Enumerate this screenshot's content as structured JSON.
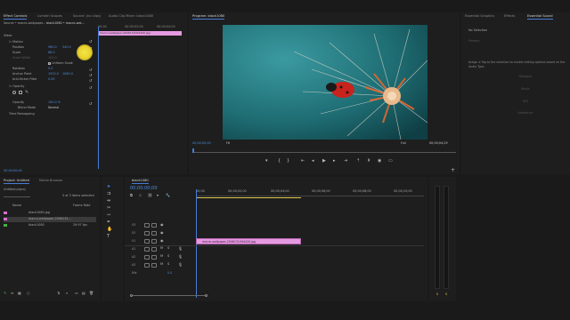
{
  "source_panel": {
    "tabs": [
      "Effect Controls",
      "Lumetri Scopes",
      "Source: (no clips)",
      "Audio Clip Mixer: black1080"
    ],
    "clip_select": "Source • macro-wallpaper...",
    "clip_select_2": "black1080 • macro-wal...",
    "section_video": "Video",
    "fx_motion": "Motion",
    "position_label": "Position",
    "position_x": "960.0",
    "position_y": "540.0",
    "scale_label": "Scale",
    "scale_value": "66.0",
    "scale_width_label": "Scale Width",
    "scale_width_value": "100.0",
    "uniform_scale": "Uniform Scale",
    "rotation_label": "Rotation",
    "rotation_value": "0.0",
    "anchor_label": "Anchor Point",
    "anchor_x": "1920.0",
    "anchor_y": "1080.0",
    "antiflicker_label": "Anti-flicker Filter",
    "antiflicker_value": "0.00",
    "opacity_section": "Opacity",
    "opacity_label": "Opacity",
    "opacity_value": "100.0 %",
    "blend_label": "Blend Mode",
    "blend_value": "Normal",
    "time_remap": "Time Remapping",
    "mini_clip": "macro-wallpaper-2006131094420.jpg",
    "ruler_start": "00:00",
    "ruler_mid": "00:00:02:00",
    "ruler_end": "00:00:04:00",
    "timecode": "00:00:00:00"
  },
  "program": {
    "title": "Program: black1080",
    "timecode": "00;00;00;00",
    "fit": "Fit",
    "quality": "Full",
    "duration": "00;00;04;29"
  },
  "essential_sound": {
    "tabs": [
      "Essential Graphics",
      "Effects",
      "Essential Sound"
    ],
    "no_selection": "No Selection",
    "presets": "Presets",
    "hint": "Assign a Tag to the selection to enable editing options based on the Audio Type.",
    "buttons": [
      "Dialogue",
      "Music",
      "SFX",
      "Ambience"
    ]
  },
  "project": {
    "tabs": [
      "Project: Untitled",
      "Media Browser"
    ],
    "file": "Untitled.prproj",
    "count": "3 of 3 items selected",
    "col_name": "Name",
    "col_rate": "Frame Rate",
    "items": [
      {
        "name": "black1080.jpg",
        "rate": "",
        "color": "#d46fd1"
      },
      {
        "name": "macro-wallpaper-2006131...",
        "rate": "",
        "color": "#d46fd1"
      },
      {
        "name": "black1080",
        "rate": "29.97 fps",
        "color": "#3fb23f"
      }
    ]
  },
  "timeline": {
    "tab": "black1080",
    "timecode": "00;00;00;00",
    "ruler": [
      "00;00",
      "00;00;02;00",
      "00;00;04;00",
      "00;00;06;00",
      "00;00;08;00",
      "00;00;10;00",
      "00;00;12;00"
    ],
    "tracks": [
      "V3",
      "V2",
      "V1",
      "A1",
      "A2",
      "A3",
      "Mix"
    ],
    "mix_value": "0.0",
    "clip": "macro-wallpaper-2006131094420.jpg"
  },
  "meters": {
    "labels": [
      "S",
      "S"
    ]
  }
}
